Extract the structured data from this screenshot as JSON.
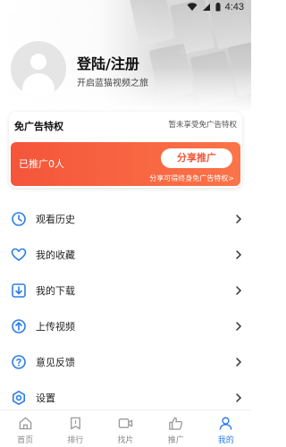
{
  "status_bar": {
    "time": "4:43"
  },
  "user": {
    "name": "登陆/注册",
    "subtitle": "开启蓝猫视频之旅"
  },
  "privilege": {
    "title": "免广告特权",
    "status": "暂未享受免广告特权",
    "promoted_count": "已推广0人",
    "share_button": "分享推广",
    "tip": "分享可得终身免广告特权>"
  },
  "menu": [
    {
      "label": "观看历史",
      "icon": "history-icon"
    },
    {
      "label": "我的收藏",
      "icon": "heart-icon"
    },
    {
      "label": "我的下载",
      "icon": "download-icon"
    },
    {
      "label": "上传视频",
      "icon": "upload-icon"
    },
    {
      "label": "意见反馈",
      "icon": "feedback-icon"
    },
    {
      "label": "设置",
      "icon": "settings-icon"
    }
  ],
  "tabbar": [
    {
      "label": "首页",
      "icon": "home-icon",
      "active": false
    },
    {
      "label": "排行",
      "icon": "ranking-icon",
      "active": false
    },
    {
      "label": "找片",
      "icon": "video-icon",
      "active": false
    },
    {
      "label": "推广",
      "icon": "thumbs-up-icon",
      "active": false
    },
    {
      "label": "我的",
      "icon": "profile-icon",
      "active": true
    }
  ],
  "colors": {
    "accent": "#2b7de9",
    "promo": "#f4553a"
  }
}
